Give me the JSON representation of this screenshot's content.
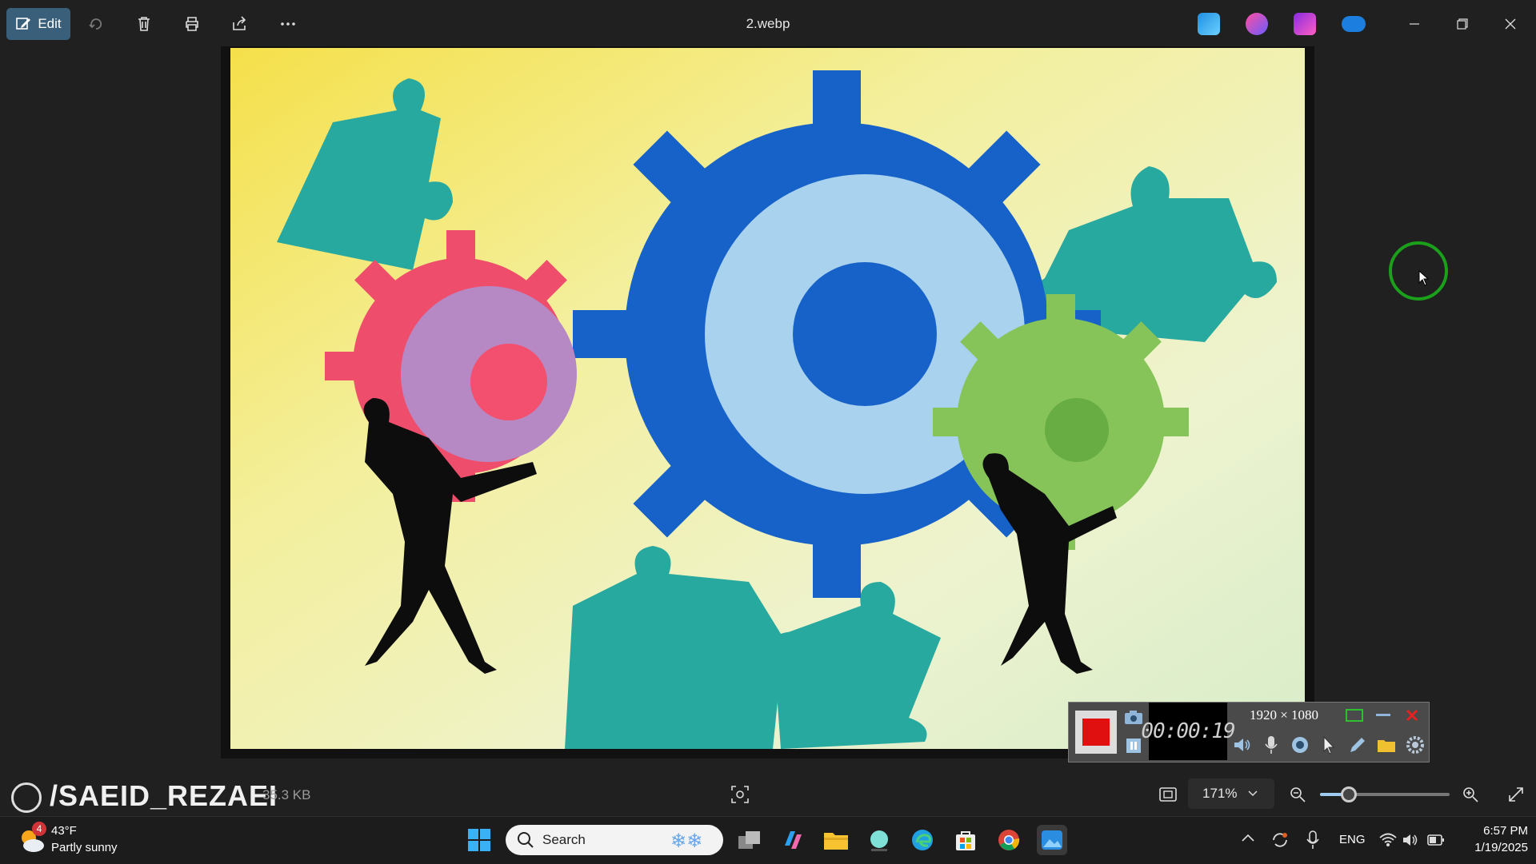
{
  "window": {
    "title": "2.webp",
    "edit_label": "Edit"
  },
  "toolbar": {
    "icons": [
      "rotate-icon",
      "delete-icon",
      "print-icon",
      "share-icon",
      "more-icon"
    ]
  },
  "recorder": {
    "timer": "00:00:19",
    "resolution": "1920 × 1080"
  },
  "status": {
    "watermark": "/SAEID_REZAEI",
    "file_size": "35.3 KB",
    "zoom": "171%",
    "zoom_level_fraction": 0.22
  },
  "taskbar": {
    "weather_temp": "43°F",
    "weather_desc": "Partly sunny",
    "weather_badge": "4",
    "search_placeholder": "Search",
    "language": "ENG",
    "time": "6:57 PM",
    "date": "1/19/2025"
  },
  "colors": {
    "accent": "#3a5f7a",
    "record": "#e01010",
    "cursor_ring": "#1aa01a"
  }
}
